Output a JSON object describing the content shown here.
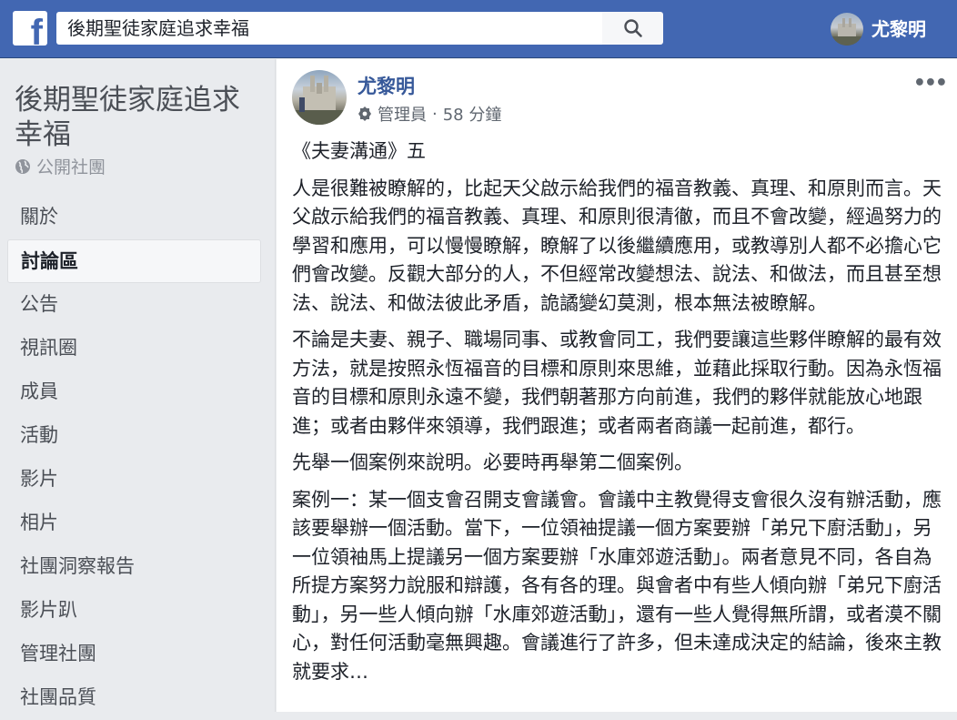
{
  "topbar": {
    "logo": "f",
    "search_value": "後期聖徒家庭追求幸福",
    "search_icon": "search-icon",
    "user_name": "尤黎明"
  },
  "sidebar": {
    "group_title": "後期聖徒家庭追求幸福",
    "group_type": "公開社團",
    "items": [
      {
        "label": "關於",
        "active": false
      },
      {
        "label": "討論區",
        "active": true
      },
      {
        "label": "公告",
        "active": false
      },
      {
        "label": "視訊圈",
        "active": false
      },
      {
        "label": "成員",
        "active": false
      },
      {
        "label": "活動",
        "active": false
      },
      {
        "label": "影片",
        "active": false
      },
      {
        "label": "相片",
        "active": false
      },
      {
        "label": "社團洞察報告",
        "active": false
      },
      {
        "label": "影片趴",
        "active": false
      },
      {
        "label": "管理社團",
        "active": false
      },
      {
        "label": "社團品質",
        "active": false
      }
    ]
  },
  "post": {
    "author": "尤黎明",
    "role": "管理員",
    "separator": "·",
    "time": "58 分鐘",
    "more": "•••",
    "paragraphs": [
      "《夫妻溝通》五",
      "人是很難被瞭解的，比起天父啟示給我們的福音教義、真理、和原則而言。天父啟示給我們的福音教義、真理、和原則很清徹，而且不會改變，經過努力的學習和應用，可以慢慢瞭解，瞭解了以後繼續應用，或教導別人都不必擔心它們會改變。反觀大部分的人，不但經常改變想法、說法、和做法，而且甚至想法、說法、和做法彼此矛盾，詭譎變幻莫測，根本無法被瞭解。",
      "不論是夫妻、親子、職場同事、或教會同工，我們要讓這些夥伴瞭解的最有效方法，就是按照永恆福音的目標和原則來思維，並藉此採取行動。因為永恆福音的目標和原則永遠不變，我們朝著那方向前進，我們的夥伴就能放心地跟進；或者由夥伴來領導，我們跟進；或者兩者商議一起前進，都行。",
      "先舉一個案例來說明。必要時再舉第二個案例。",
      "案例一：某一個支會召開支會議會。會議中主教覺得支會很久沒有辦活動，應該要舉辦一個活動。當下，一位領袖提議一個方案要辦「弟兄下廚活動」，另一位領袖馬上提議另一個方案要辦「水庫郊遊活動」。兩者意見不同，各自為所提方案努力說服和辯護，各有各的理。與會者中有些人傾向辦「弟兄下廚活動」，另一些人傾向辦「水庫郊遊活動」，還有一些人覺得無所謂，或者漠不關心，對任何活動毫無興趣。會議進行了許多，但未達成決定的結論，後來主教就要求…"
    ]
  },
  "colors": {
    "brand": "#4267b2",
    "link": "#365899",
    "background": "#e9ebee"
  }
}
